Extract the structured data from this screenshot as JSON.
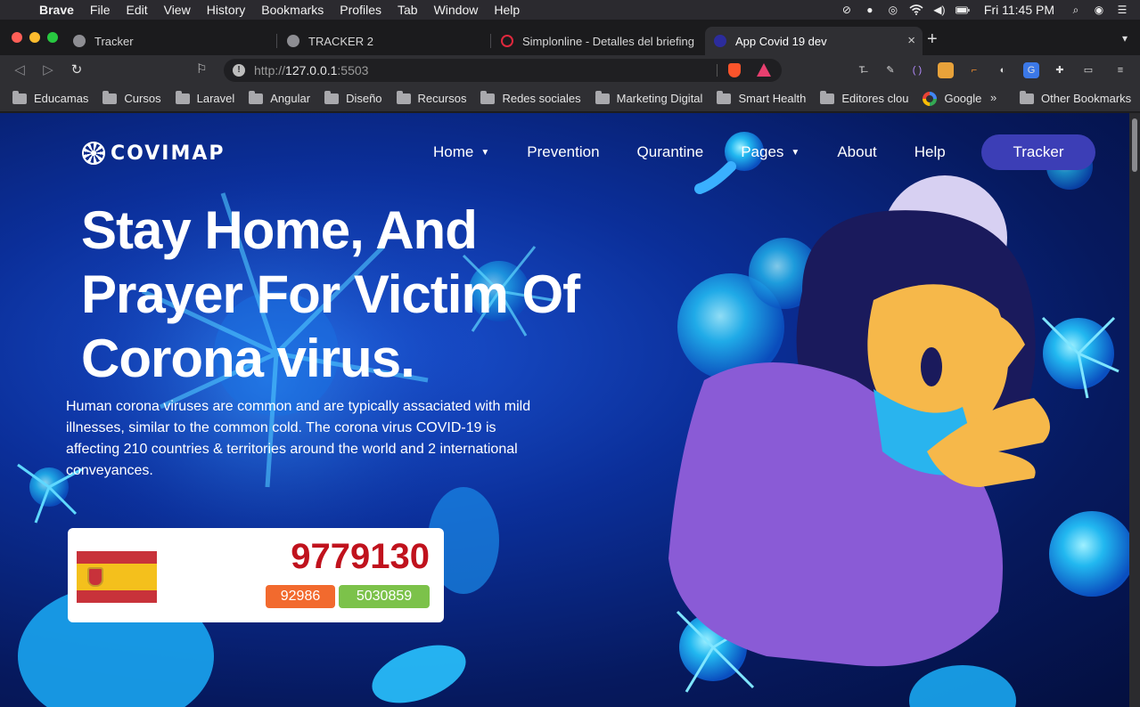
{
  "menubar": {
    "apple_icon": "apple-icon",
    "app": "Brave",
    "items": [
      "File",
      "Edit",
      "View",
      "History",
      "Bookmarks",
      "Profiles",
      "Tab",
      "Window",
      "Help"
    ],
    "clock": "Fri 11:45 PM"
  },
  "tabs": [
    {
      "title": "Tracker",
      "icon": "globe-icon"
    },
    {
      "title": "TRACKER 2",
      "icon": "globe-icon"
    },
    {
      "title": "Simplonline - Detalles del briefing",
      "icon": "simplon-icon"
    },
    {
      "title": "App Covid 19 dev",
      "icon": "covid-app-icon",
      "active": true
    }
  ],
  "toolbar": {
    "url_scheme": "http://",
    "url_host": "127.0.0.1",
    "url_port": ":5503"
  },
  "bookmarks": {
    "items": [
      "Educamas",
      "Cursos",
      "Laravel",
      "Angular",
      "Diseño",
      "Recursos",
      "Redes sociales",
      "Marketing Digital",
      "Smart Health",
      "Editores clou"
    ],
    "google": "Google",
    "more": "»",
    "other": "Other Bookmarks"
  },
  "site": {
    "logo": "COVIMAP",
    "nav": [
      {
        "label": "Home",
        "dropdown": true
      },
      {
        "label": "Prevention",
        "dropdown": false
      },
      {
        "label": "Qurantine",
        "dropdown": false
      },
      {
        "label": "Pages",
        "dropdown": true
      },
      {
        "label": "About",
        "dropdown": false
      },
      {
        "label": "Help",
        "dropdown": false
      }
    ],
    "tracker_button": "Tracker",
    "hero_title": "Stay Home, And Prayer For Victim Of Corona virus.",
    "hero_text": "Human corona viruses are common and are typically assaciated with mild illnesses, similar to the common cold. The corona virus COVID-19 is affecting 210 countries & territories around the world and 2 international conveyances.",
    "stats": {
      "flag": "spain-flag-icon",
      "cases": "9779130",
      "deaths": "92986",
      "recovered": "5030859"
    }
  },
  "colors": {
    "accent_button": "#3c3eb6",
    "cases_red": "#c0121d",
    "deaths_orange": "#f26a2e",
    "recovered_green": "#7cc24a"
  }
}
